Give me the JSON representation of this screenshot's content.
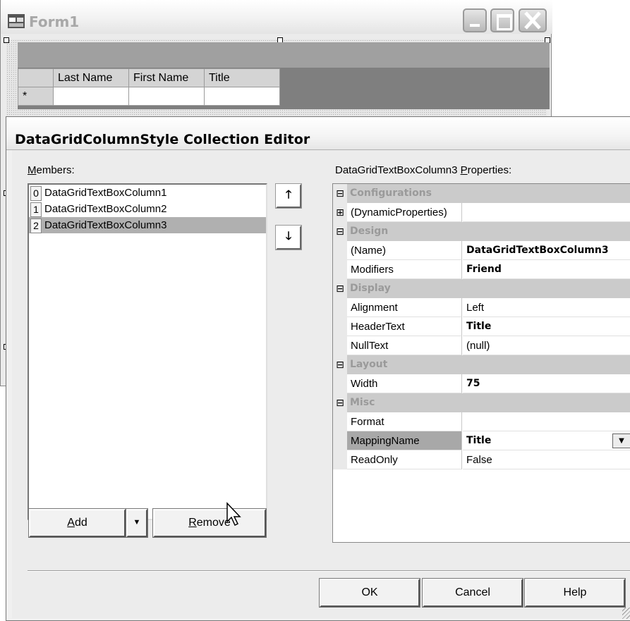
{
  "form1": {
    "title": "Form1",
    "grid": {
      "columns": [
        "",
        "Last Name",
        "First Name",
        "Title"
      ],
      "new_row_marker": "*"
    }
  },
  "dialog": {
    "title": "DataGridColumnStyle Collection Editor",
    "members_label": "Members:",
    "members": [
      {
        "index": "0",
        "name": "DataGridTextBoxColumn1",
        "selected": false
      },
      {
        "index": "1",
        "name": "DataGridTextBoxColumn2",
        "selected": false
      },
      {
        "index": "2",
        "name": "DataGridTextBoxColumn3",
        "selected": true
      }
    ],
    "move_up_glyph": "🡑",
    "move_down_glyph": "🡓",
    "properties_label": "DataGridTextBoxColumn3 Properties:",
    "properties": [
      {
        "category": "Configurations",
        "expander": "⊟"
      },
      {
        "name": "(DynamicProperties)",
        "value": "",
        "expander": "⊞"
      },
      {
        "category": "Design",
        "expander": "⊟"
      },
      {
        "name": "(Name)",
        "value": "DataGridTextBoxColumn3",
        "bold": true
      },
      {
        "name": "Modifiers",
        "value": "Friend",
        "bold": true
      },
      {
        "category": "Display",
        "expander": "⊟"
      },
      {
        "name": "Alignment",
        "value": "Left"
      },
      {
        "name": "HeaderText",
        "value": "Title",
        "bold": true
      },
      {
        "name": "NullText",
        "value": "(null)"
      },
      {
        "category": "Layout",
        "expander": "⊟"
      },
      {
        "name": "Width",
        "value": "75",
        "bold": true
      },
      {
        "category": "Misc",
        "expander": "⊟"
      },
      {
        "name": "Format",
        "value": ""
      },
      {
        "name": "MappingName",
        "value": "Title",
        "bold": true,
        "highlighted": true,
        "dropdown": true
      },
      {
        "name": "ReadOnly",
        "value": "False"
      }
    ],
    "buttons": {
      "add": "Add",
      "remove": "Remove",
      "ok": "OK",
      "cancel": "Cancel",
      "help": "Help"
    }
  }
}
